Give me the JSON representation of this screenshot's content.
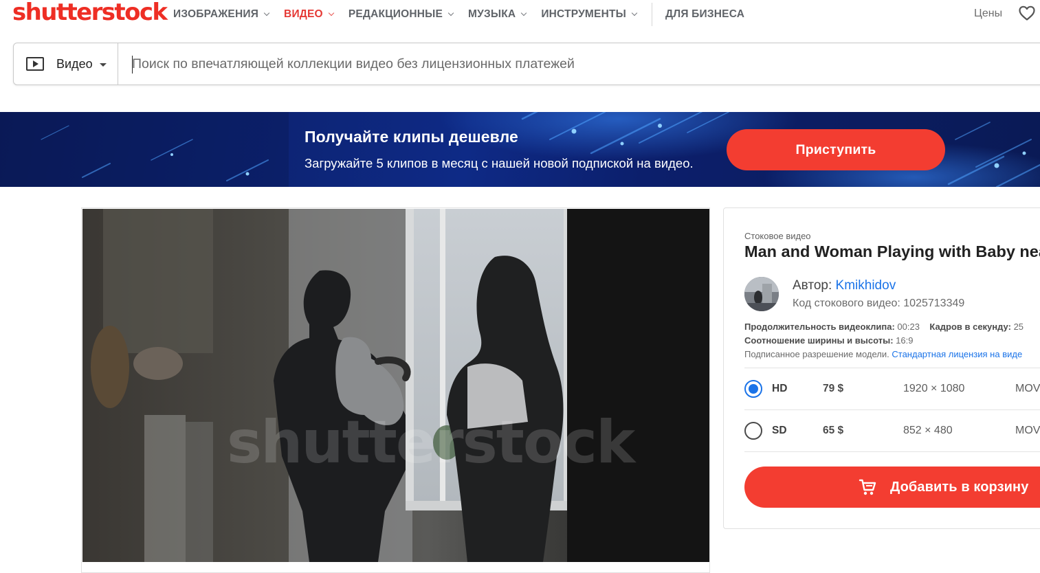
{
  "brand": {
    "logo_text": "shutterstock",
    "accent": "#ee2e24"
  },
  "nav": {
    "items": [
      {
        "label": "ИЗОБРАЖЕНИЯ",
        "dropdown": true,
        "active": false
      },
      {
        "label": "ВИДЕО",
        "dropdown": true,
        "active": true
      },
      {
        "label": "РЕДАКЦИОННЫЕ",
        "dropdown": true,
        "active": false
      },
      {
        "label": "МУЗЫКА",
        "dropdown": true,
        "active": false
      },
      {
        "label": "ИНСТРУМЕНТЫ",
        "dropdown": true,
        "active": false
      }
    ],
    "business": "ДЛЯ БИЗНЕСА",
    "prices": "Цены",
    "favorites_icon": "heart-icon"
  },
  "search": {
    "type_icon": "video-play-icon",
    "type_label": "Видео",
    "placeholder": "Поиск по впечатляющей коллекции видео без лицензионных платежей",
    "value": ""
  },
  "banner": {
    "title": "Получайте клипы дешевле",
    "subtitle": "Загружайте 5 клипов в месяц с нашей новой подпиской на видео.",
    "cta": "Приступить",
    "cta_color": "#f33d31"
  },
  "preview": {
    "watermark": "shutterstock"
  },
  "details": {
    "kicker": "Стоковое видео",
    "title": "Man and Woman Playing with Baby near",
    "author_label": "Автор:",
    "author_name": "Kmikhidov",
    "code": "Код стокового видео: 1025713349",
    "duration_label": "Продолжительность видеоклипа:",
    "duration_value": "00:23",
    "fps_label": "Кадров в секунду:",
    "fps_value": "25",
    "aspect_label": "Соотношение ширины и высоты:",
    "aspect_value": "16:9",
    "release_label": "Подписанное разрешение модели.",
    "license_link": "Стандартная лицензия на виде",
    "options": [
      {
        "quality": "HD",
        "price": "79 $",
        "resolution": "1920 × 1080",
        "format": "MOV",
        "selected": true
      },
      {
        "quality": "SD",
        "price": "65 $",
        "resolution": "852 × 480",
        "format": "MOV",
        "selected": false
      }
    ],
    "cart_icon": "shopping-cart-icon",
    "cart_label": "Добавить в корзину"
  }
}
